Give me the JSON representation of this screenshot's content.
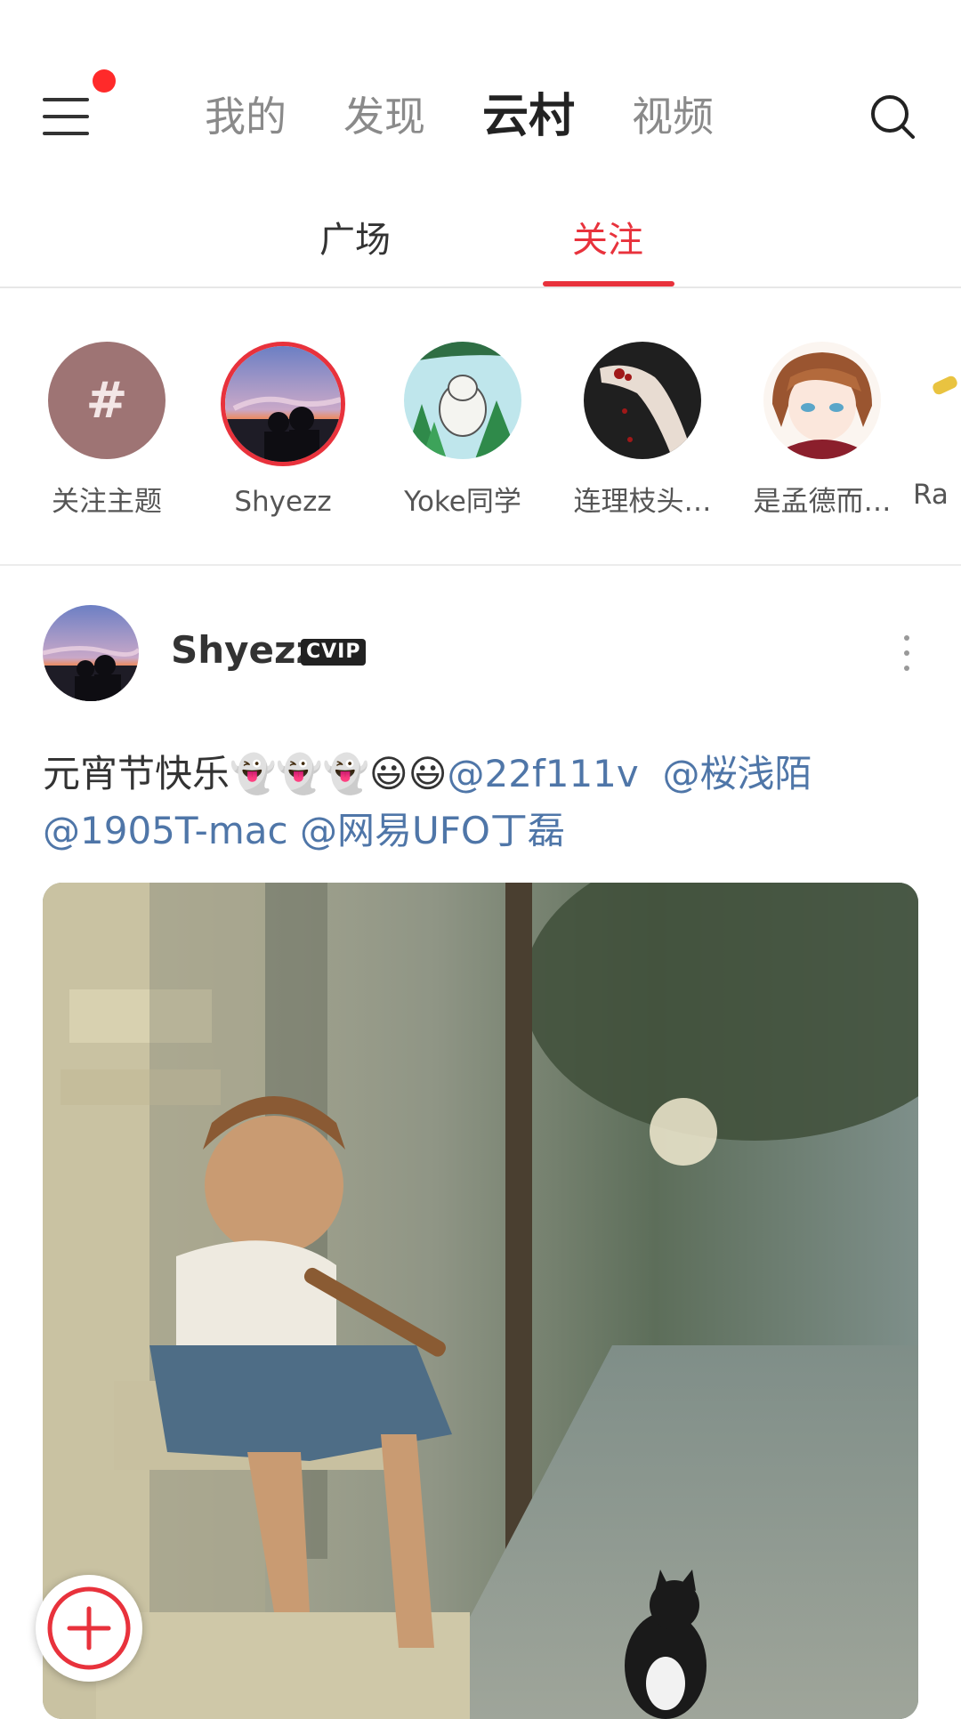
{
  "nav": {
    "tabs": [
      "我的",
      "发现",
      "云村",
      "视频"
    ],
    "active_tab": "云村"
  },
  "subnav": {
    "tabs": [
      "广场",
      "关注"
    ],
    "active_tab": "关注"
  },
  "following": [
    {
      "name": "关注主题",
      "avatar": "topic-hash-icon",
      "glyph": "#"
    },
    {
      "name": "Shyezz",
      "avatar": "sunset-photo",
      "has_new": true
    },
    {
      "name": "Yoke同学",
      "avatar": "cartoon-bear"
    },
    {
      "name": "连理枝头…",
      "avatar": "dark-hand"
    },
    {
      "name": "是孟德而…",
      "avatar": "anime-girl"
    },
    {
      "name": "Ra",
      "avatar": "partial"
    }
  ],
  "post": {
    "user": "Shyezz",
    "badge": "CVIP",
    "text_plain": "元宵节快乐",
    "emoji": [
      "👻",
      "👻",
      "👻",
      "😃",
      "😃"
    ],
    "mentions": [
      "@22f111v",
      "@桜浅陌",
      "@1905T-mac",
      "@网易UFO丁磊"
    ],
    "image": "boy-playing-flute-with-cat"
  },
  "colors": {
    "accent": "#e8323c",
    "mention": "#4f76a8",
    "text": "#333333",
    "muted": "#8a8a8a"
  }
}
